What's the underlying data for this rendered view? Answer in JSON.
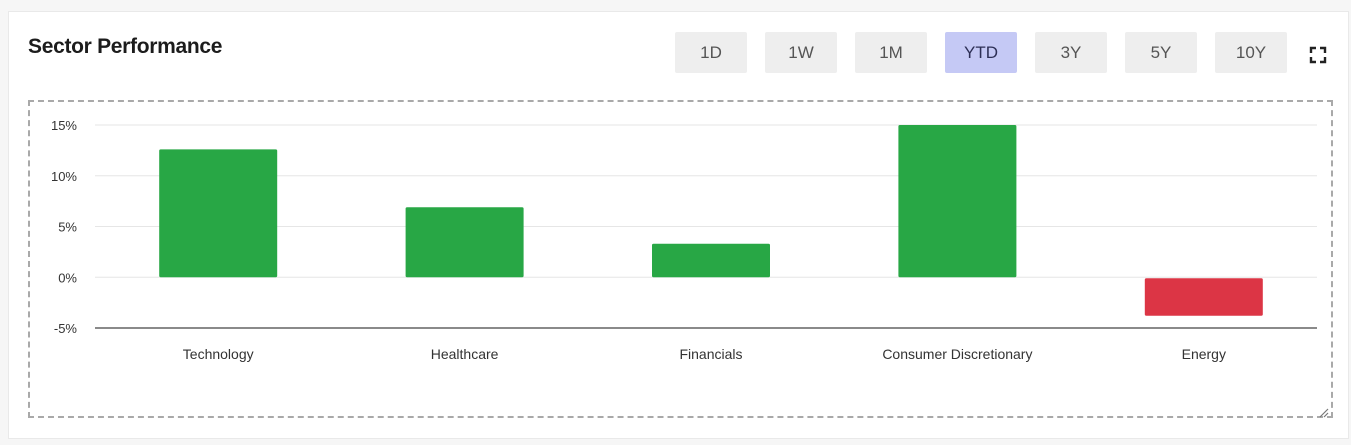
{
  "title": "Sector Performance",
  "range_tabs": [
    {
      "label": "1D",
      "active": false
    },
    {
      "label": "1W",
      "active": false
    },
    {
      "label": "1M",
      "active": false
    },
    {
      "label": "YTD",
      "active": true
    },
    {
      "label": "3Y",
      "active": false
    },
    {
      "label": "5Y",
      "active": false
    },
    {
      "label": "10Y",
      "active": false
    }
  ],
  "icons": {
    "fullscreen": "fullscreen-icon",
    "resize": "resize-handle-icon"
  },
  "colors": {
    "positive": "#28a745",
    "negative": "#dc3545",
    "active_tab": "#c5c9f5"
  },
  "chart_data": {
    "type": "bar",
    "categories": [
      "Technology",
      "Healthcare",
      "Financials",
      "Consumer Discretionary",
      "Energy"
    ],
    "values": [
      12.6,
      6.9,
      3.3,
      15.0,
      -3.7
    ],
    "yticks": [
      "15%",
      "10%",
      "5%",
      "0%",
      "-5%"
    ],
    "ylim": [
      -5,
      15
    ],
    "grid": true,
    "legend": "none"
  }
}
